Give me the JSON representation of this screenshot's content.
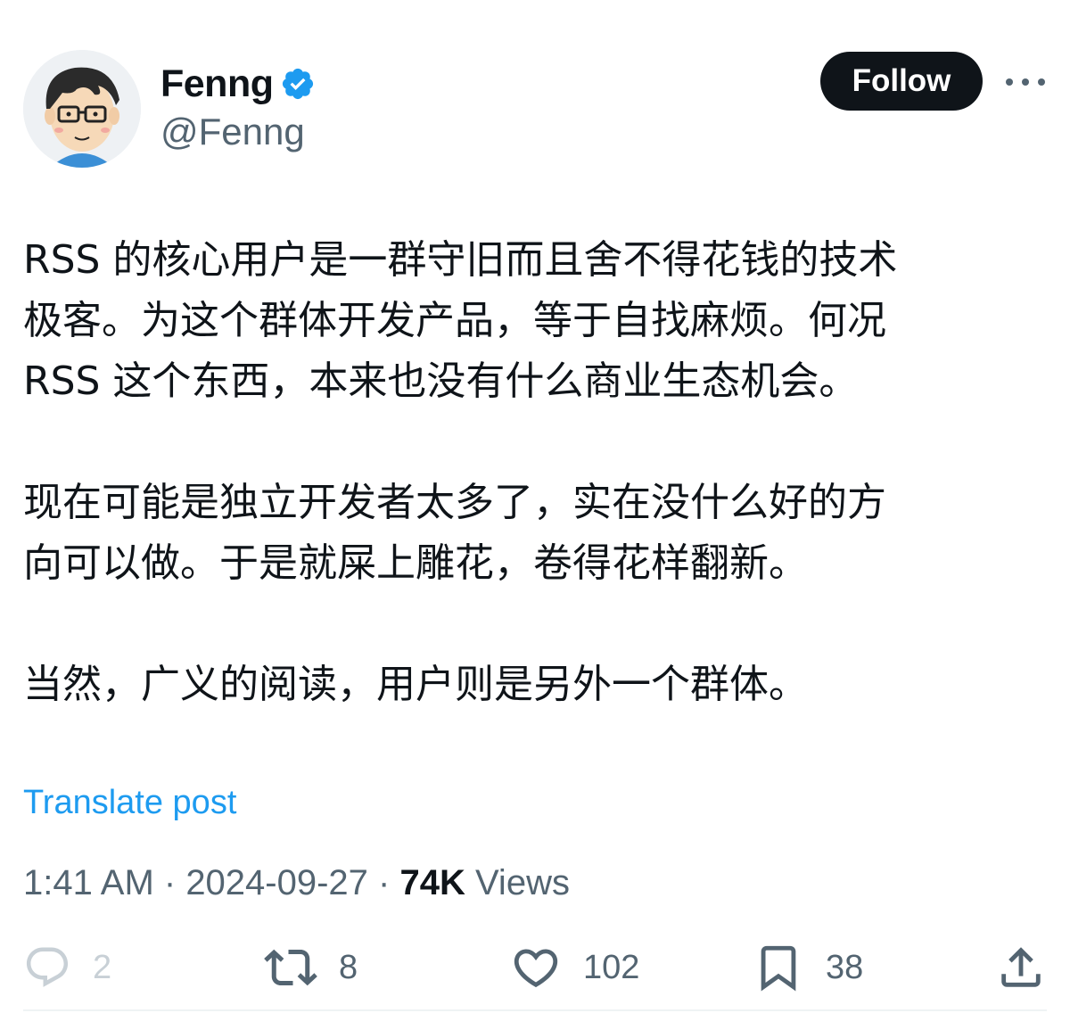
{
  "author": {
    "display_name": "Fenng",
    "handle": "@Fenng",
    "avatar_icon": "cartoon-avatar-glasses",
    "verified_icon": "verified-badge-icon",
    "verified_color": "#1d9bf0"
  },
  "header": {
    "follow_label": "Follow",
    "more_icon": "more-horizontal-icon"
  },
  "post": {
    "paragraphs": [
      "RSS 的核心用户是一群守旧而且舍不得花钱的技术\n极客。为这个群体开发产品，等于自找麻烦。何况\nRSS 这个东西，本来也没有什么商业生态机会。",
      "现在可能是独立开发者太多了，实在没什么好的方\n向可以做。于是就屎上雕花，卷得花样翻新。",
      "当然，广义的阅读，用户则是另外一个群体。"
    ],
    "translate_label": "Translate post"
  },
  "meta": {
    "time": "1:41 AM",
    "separator": " · ",
    "date": "2024-09-27",
    "views_count": "74K",
    "views_label": " Views"
  },
  "actions": {
    "replies": {
      "icon": "reply-icon",
      "count": "2"
    },
    "reposts": {
      "icon": "repost-icon",
      "count": "8"
    },
    "likes": {
      "icon": "heart-icon",
      "count": "102"
    },
    "bookmarks": {
      "icon": "bookmark-icon",
      "count": "38"
    },
    "share": {
      "icon": "share-icon"
    }
  },
  "colors": {
    "text_primary": "#0f1419",
    "text_secondary": "#536471",
    "accent": "#1d9bf0",
    "button_bg": "#0f1419"
  }
}
